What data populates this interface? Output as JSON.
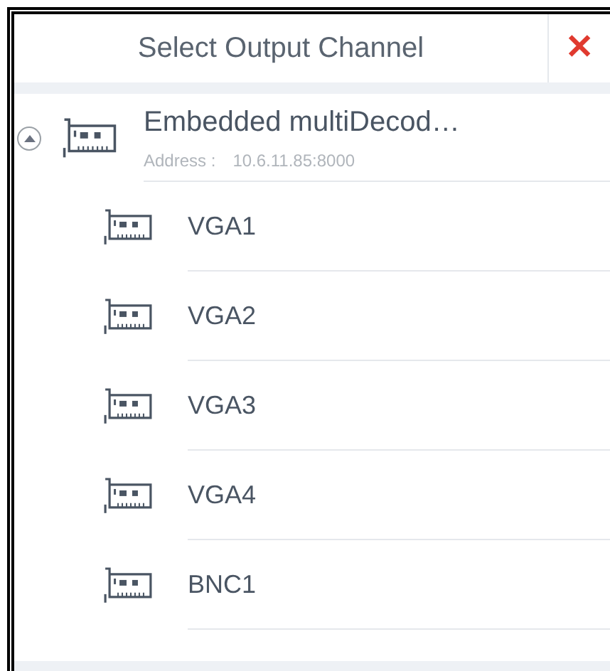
{
  "dialog": {
    "title": "Select Output Channel",
    "close": "✕"
  },
  "device": {
    "name": "Embedded multiDecod…",
    "address_label": "Address :",
    "address": "10.6.11.85:8000",
    "expanded": true,
    "channels": [
      {
        "name": "VGA1"
      },
      {
        "name": "VGA2"
      },
      {
        "name": "VGA3"
      },
      {
        "name": "VGA4"
      },
      {
        "name": "BNC1"
      }
    ]
  }
}
